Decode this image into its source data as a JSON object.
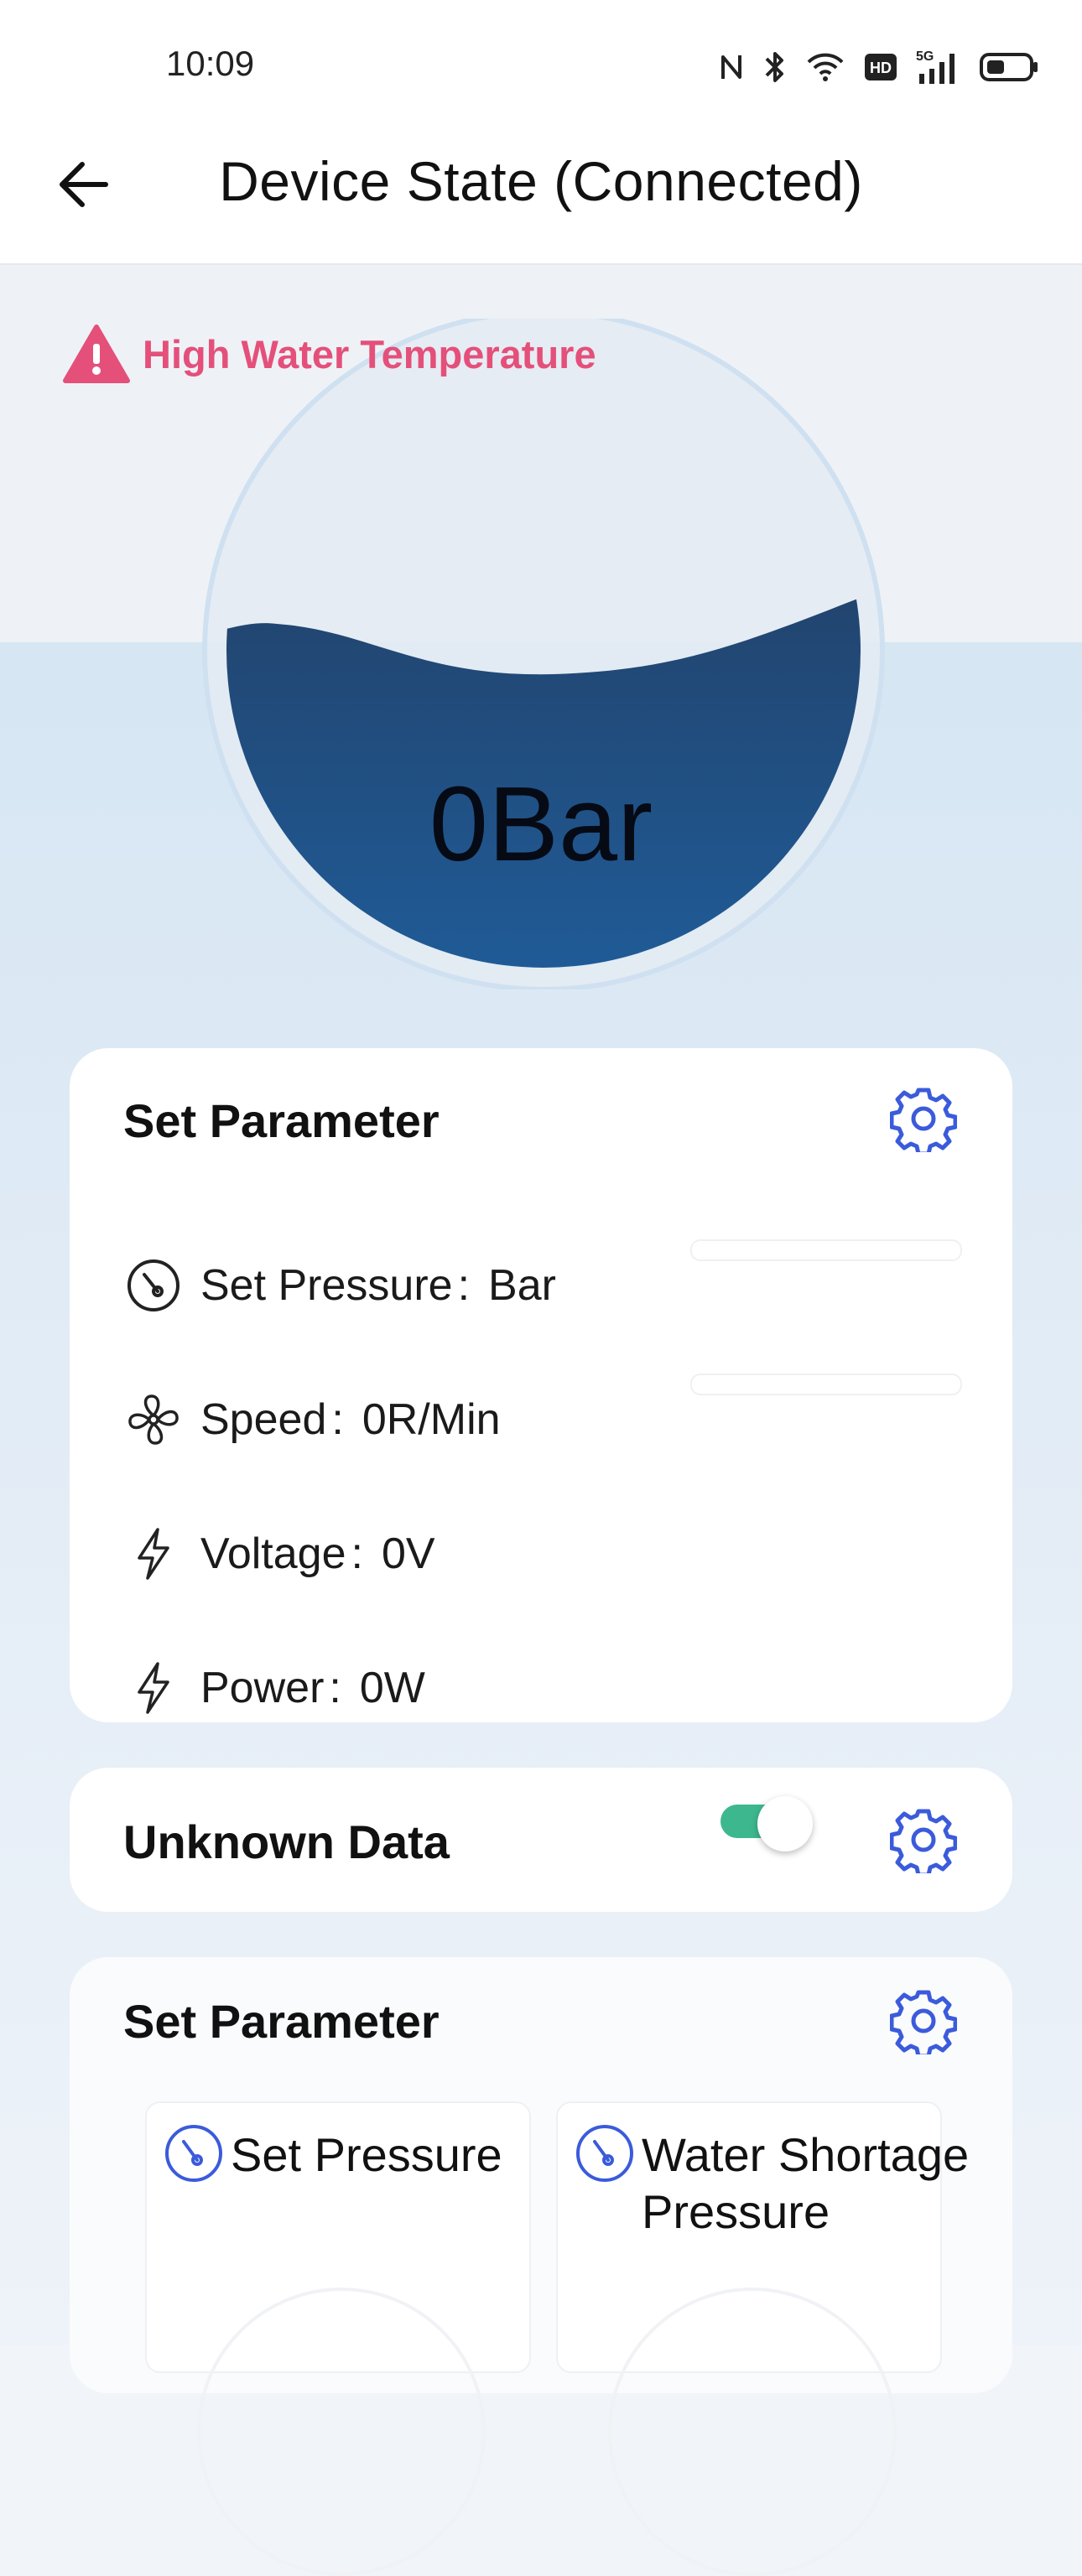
{
  "status_bar": {
    "time": "10:09",
    "icons": [
      "nfc-icon",
      "bluetooth-icon",
      "wifi-icon",
      "hd-icon",
      "5g-signal-icon",
      "battery-icon"
    ],
    "network_label": "5G",
    "hd_label": "HD"
  },
  "app_bar": {
    "title": "Device State (Connected)",
    "back_icon": "arrow-left-icon"
  },
  "alarm": {
    "text": "High Water Temperature",
    "icon": "warning-triangle-icon",
    "color": "#e4507a"
  },
  "gauge": {
    "value": "0Bar",
    "fill_level": 0.53,
    "fill_color_top": "#22446e",
    "fill_color_bottom": "#1f5c99"
  },
  "card_params": {
    "title": "Set Parameter",
    "settings_icon": "gear-icon",
    "rows": [
      {
        "icon": "gauge-icon",
        "label": "Set Pressure",
        "sep": ":",
        "value": "Bar",
        "has_slider": true
      },
      {
        "icon": "fan-icon",
        "label": "Speed",
        "sep": ":",
        "value": "0R/Min",
        "has_slider": true
      },
      {
        "icon": "lightning-icon",
        "label": "Voltage",
        "sep": ":",
        "value": "0V",
        "has_slider": false
      },
      {
        "icon": "lightning-icon",
        "label": "Power",
        "sep": ":",
        "value": "0W",
        "has_slider": false
      }
    ]
  },
  "card_unknown": {
    "title": "Unknown Data",
    "toggle_on": true,
    "toggle_color": "#3db88e",
    "settings_icon": "gear-icon"
  },
  "card_set_param2": {
    "title": "Set Parameter",
    "settings_icon": "gear-icon",
    "items": [
      {
        "icon": "gauge-icon",
        "label": "Set Pressure"
      },
      {
        "icon": "gauge-icon",
        "label": "Water Shortage Pressure"
      }
    ]
  },
  "colors": {
    "accent": "#3b5bdb",
    "alarm": "#e4507a"
  }
}
